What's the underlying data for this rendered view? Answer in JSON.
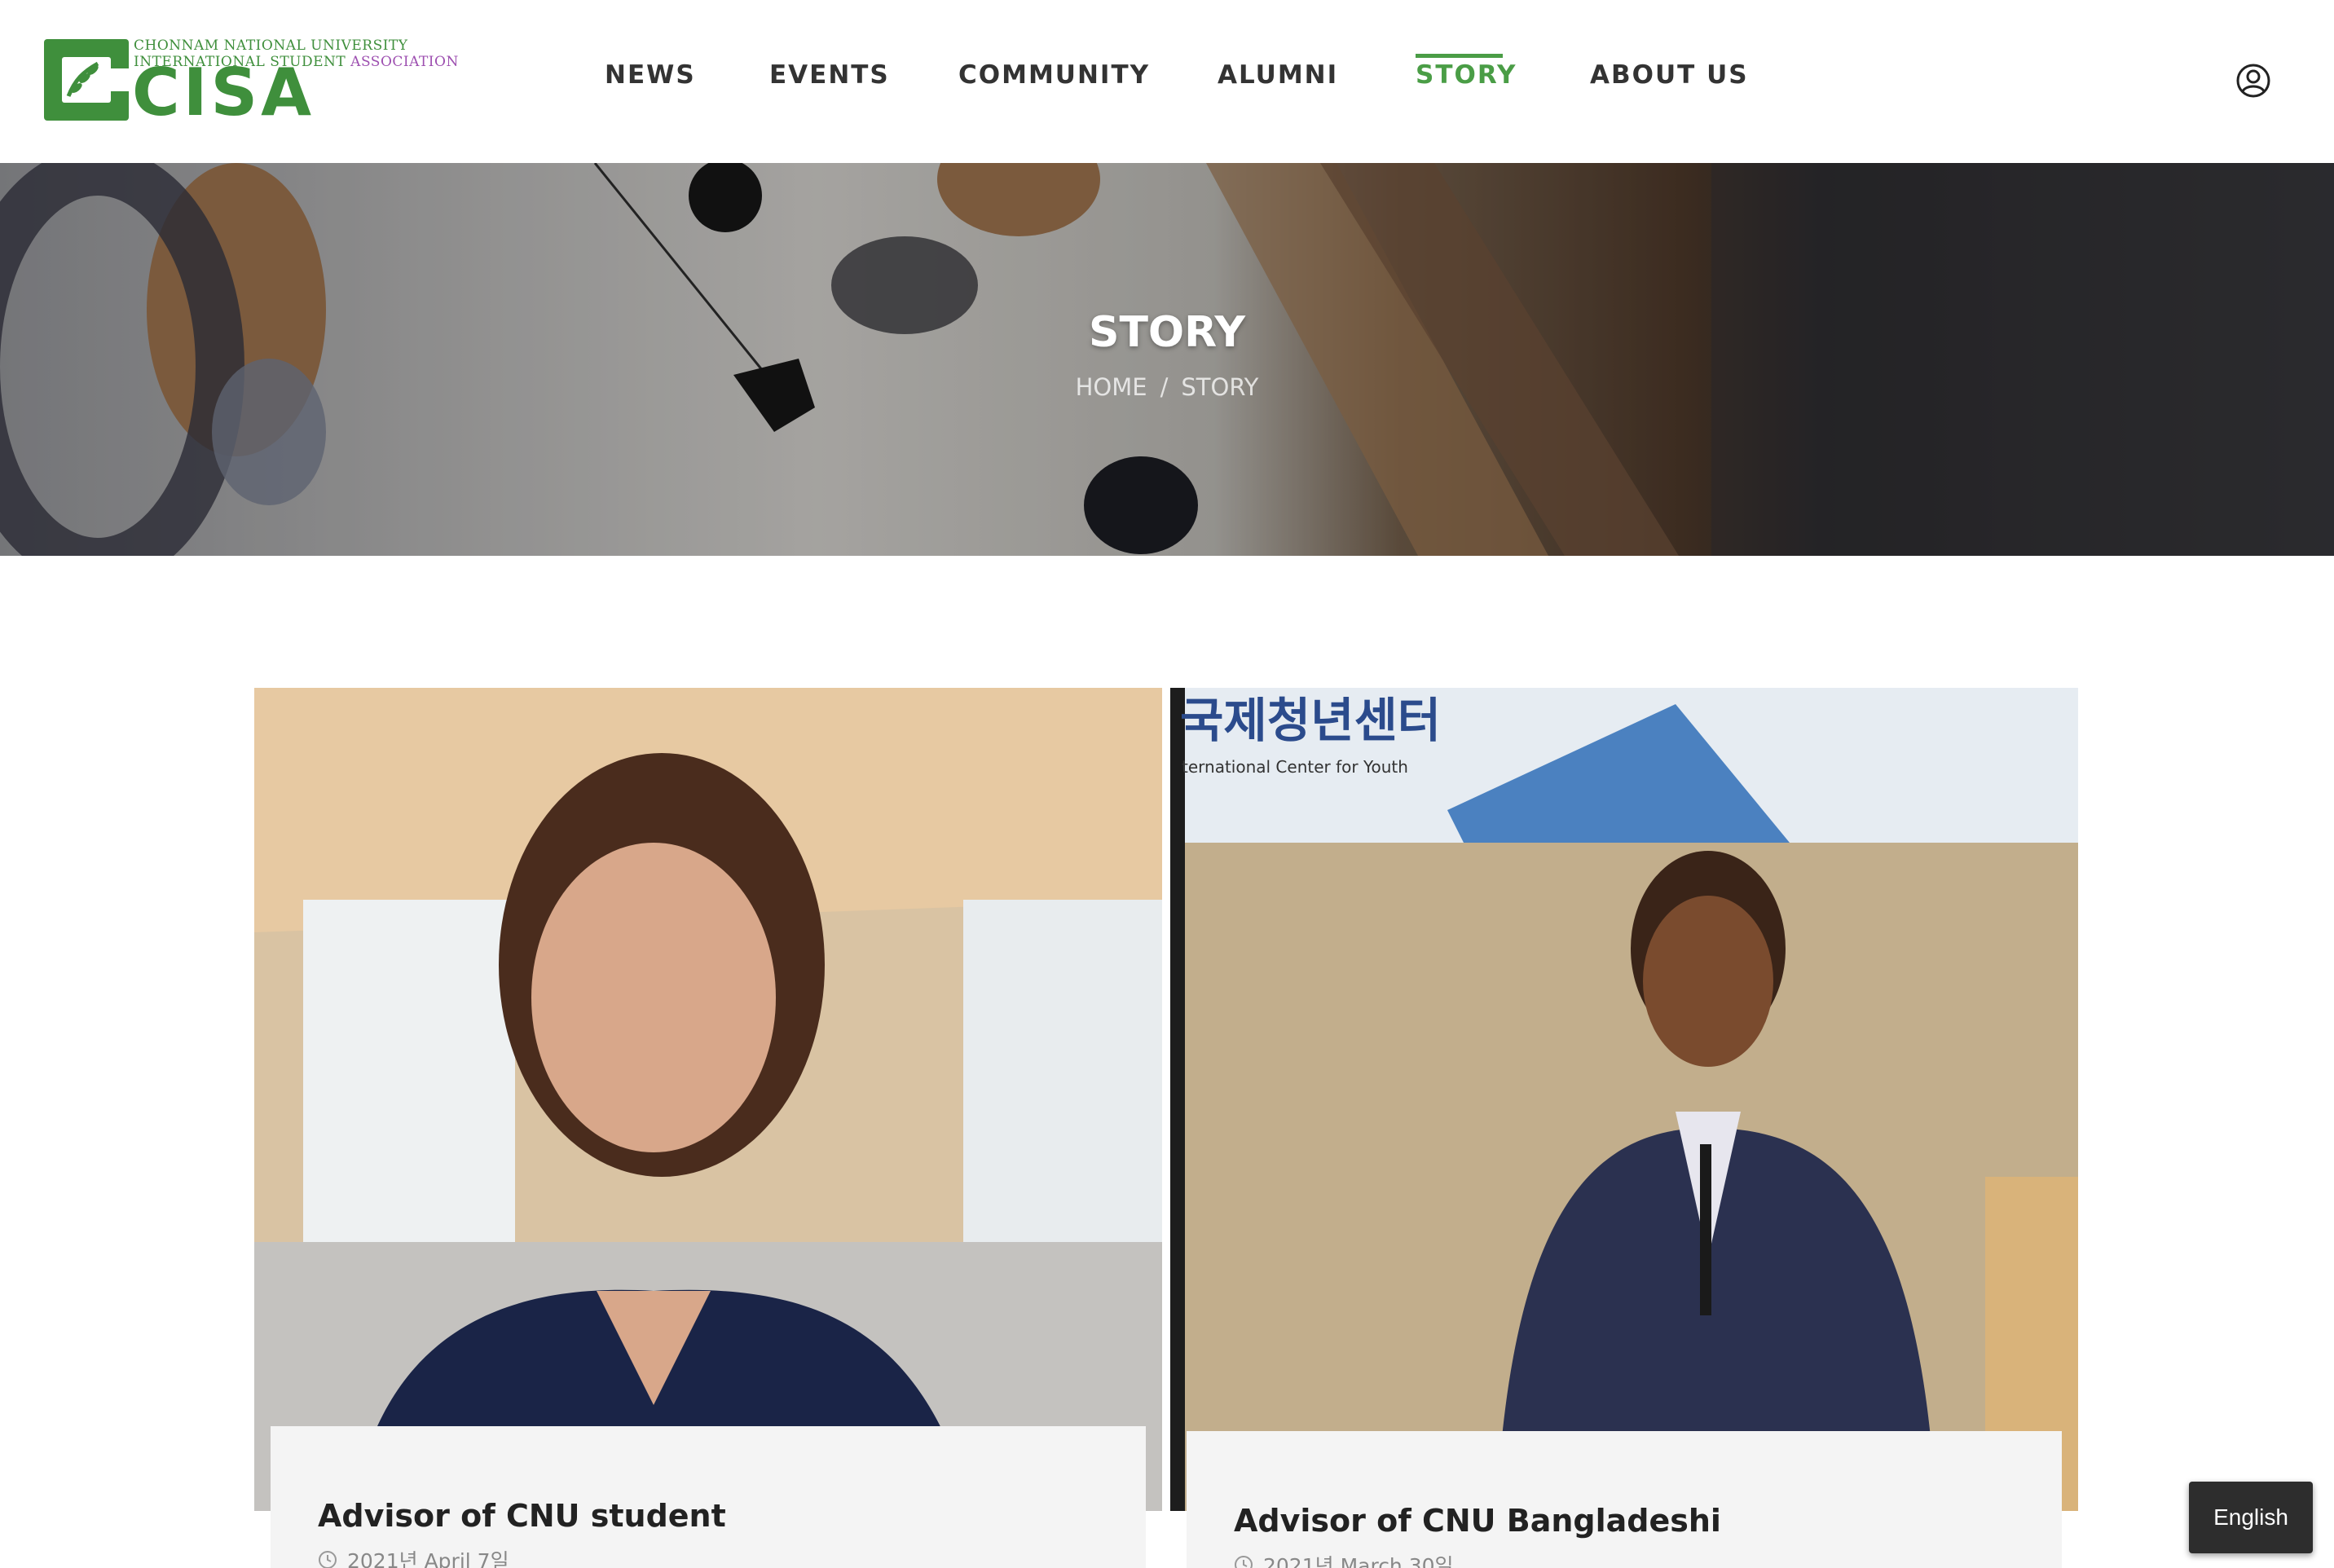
{
  "header": {
    "logo": {
      "line1": "CHONNAM NATIONAL UNIVERSITY",
      "line2_a": "INTERNATIONAL STUDENT ",
      "line2_b": "ASSOCIATION",
      "wordmark": "CISA",
      "icon": "laurel-logo-icon"
    },
    "nav": [
      {
        "label": "NEWS"
      },
      {
        "label": "EVENTS"
      },
      {
        "label": "COMMUNITY"
      },
      {
        "label": "ALUMNI"
      },
      {
        "label": "STORY",
        "active": true
      },
      {
        "label": "ABOUT US"
      }
    ],
    "user_icon": "user-circle-icon"
  },
  "hero": {
    "title": "STORY",
    "breadcrumb": {
      "home": "HOME",
      "separator": "/",
      "current": "STORY"
    }
  },
  "cards": [
    {
      "title": "Advisor of CNU student",
      "date": "2021년 April 7일",
      "icon": "clock-icon"
    },
    {
      "title": "Advisor of CNU Bangladeshi",
      "date": "2021년 March 30일",
      "icon": "clock-icon"
    }
  ],
  "photo2_banner": {
    "korean": "국제청년센터",
    "english": "ternational Center for Youth"
  },
  "language": {
    "label": "English"
  },
  "colors": {
    "accent": "#4a9d46",
    "logo_purple": "#9d4fb0",
    "card_info_bg": "#f4f4f4",
    "lang_bg": "#2d2d2d"
  }
}
